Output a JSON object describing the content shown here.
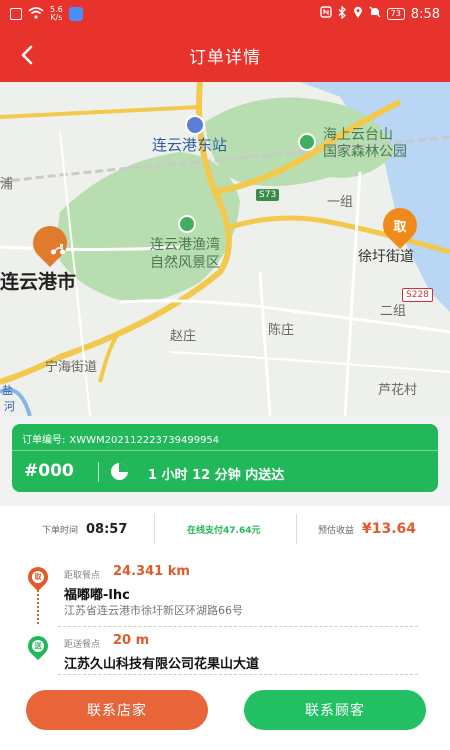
{
  "status_bar": {
    "speed_value": "5.6",
    "speed_unit": "K/s",
    "battery": "73",
    "time": "8:58"
  },
  "header": {
    "title": "订单详情"
  },
  "map": {
    "labels": {
      "lianyungang_east_station": "连云港东站",
      "haishang_park_line1": "海上云台山",
      "haishang_park_line2": "国家森林公园",
      "yuwan_line1": "连云港渔湾",
      "yuwan_line2": "自然风景区",
      "city": "连云港市",
      "yizu": "一组",
      "xuyu_street": "徐圩街道",
      "erzu": "二组",
      "zhaozhuang": "赵庄",
      "chenzhuang": "陈庄",
      "ninghai_street": "宁海街道",
      "luhuacun": "芦花村",
      "edge_pu": "浦",
      "edge_yan": "盐",
      "edge_he": "河"
    },
    "road_shields": {
      "s73": "S73",
      "s228": "S228"
    },
    "pickup_marker": "取"
  },
  "order": {
    "number_label": "订单编号:",
    "number": "XWWM202112223739499954",
    "seq": "#000",
    "delivery_time": "1 小时  12 分钟 内送达"
  },
  "info": {
    "order_time_label": "下单时间",
    "order_time": "08:57",
    "payment": "在线支付47.64元",
    "income_label": "预估收益",
    "income": "¥13.64"
  },
  "pickup": {
    "pin_char": "取",
    "distance_label": "距取餐点",
    "distance": "24.341 km",
    "name": "福嘟嘟-lhc",
    "address": "江苏省连云港市徐圩新区环湖路66号"
  },
  "dropoff": {
    "pin_char": "送",
    "distance_label": "距送餐点",
    "distance": "20 m",
    "name": "江苏久山科技有限公司花果山大道"
  },
  "buttons": {
    "contact_shop": "联系店家",
    "contact_customer": "联系顾客"
  },
  "colors": {
    "header_red": "#e8322c",
    "card_green": "#22b85a",
    "accent_orange": "#e05a2c"
  }
}
